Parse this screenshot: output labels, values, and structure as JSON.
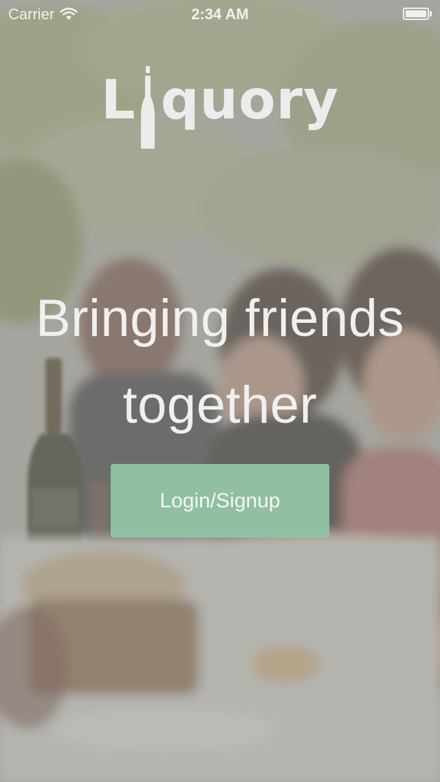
{
  "status_bar": {
    "carrier": "Carrier",
    "time": "2:34 AM",
    "battery_level": 1.0
  },
  "logo": {
    "first_letter": "L",
    "rest": "quory",
    "icon": "bottle-icon"
  },
  "tagline": {
    "line1": "Bringing friends",
    "line2": "together"
  },
  "login_button": {
    "label": "Login/Signup"
  },
  "colors": {
    "button": "#93c4a6",
    "overlay": "#969692",
    "text": "#f0f0f0"
  }
}
